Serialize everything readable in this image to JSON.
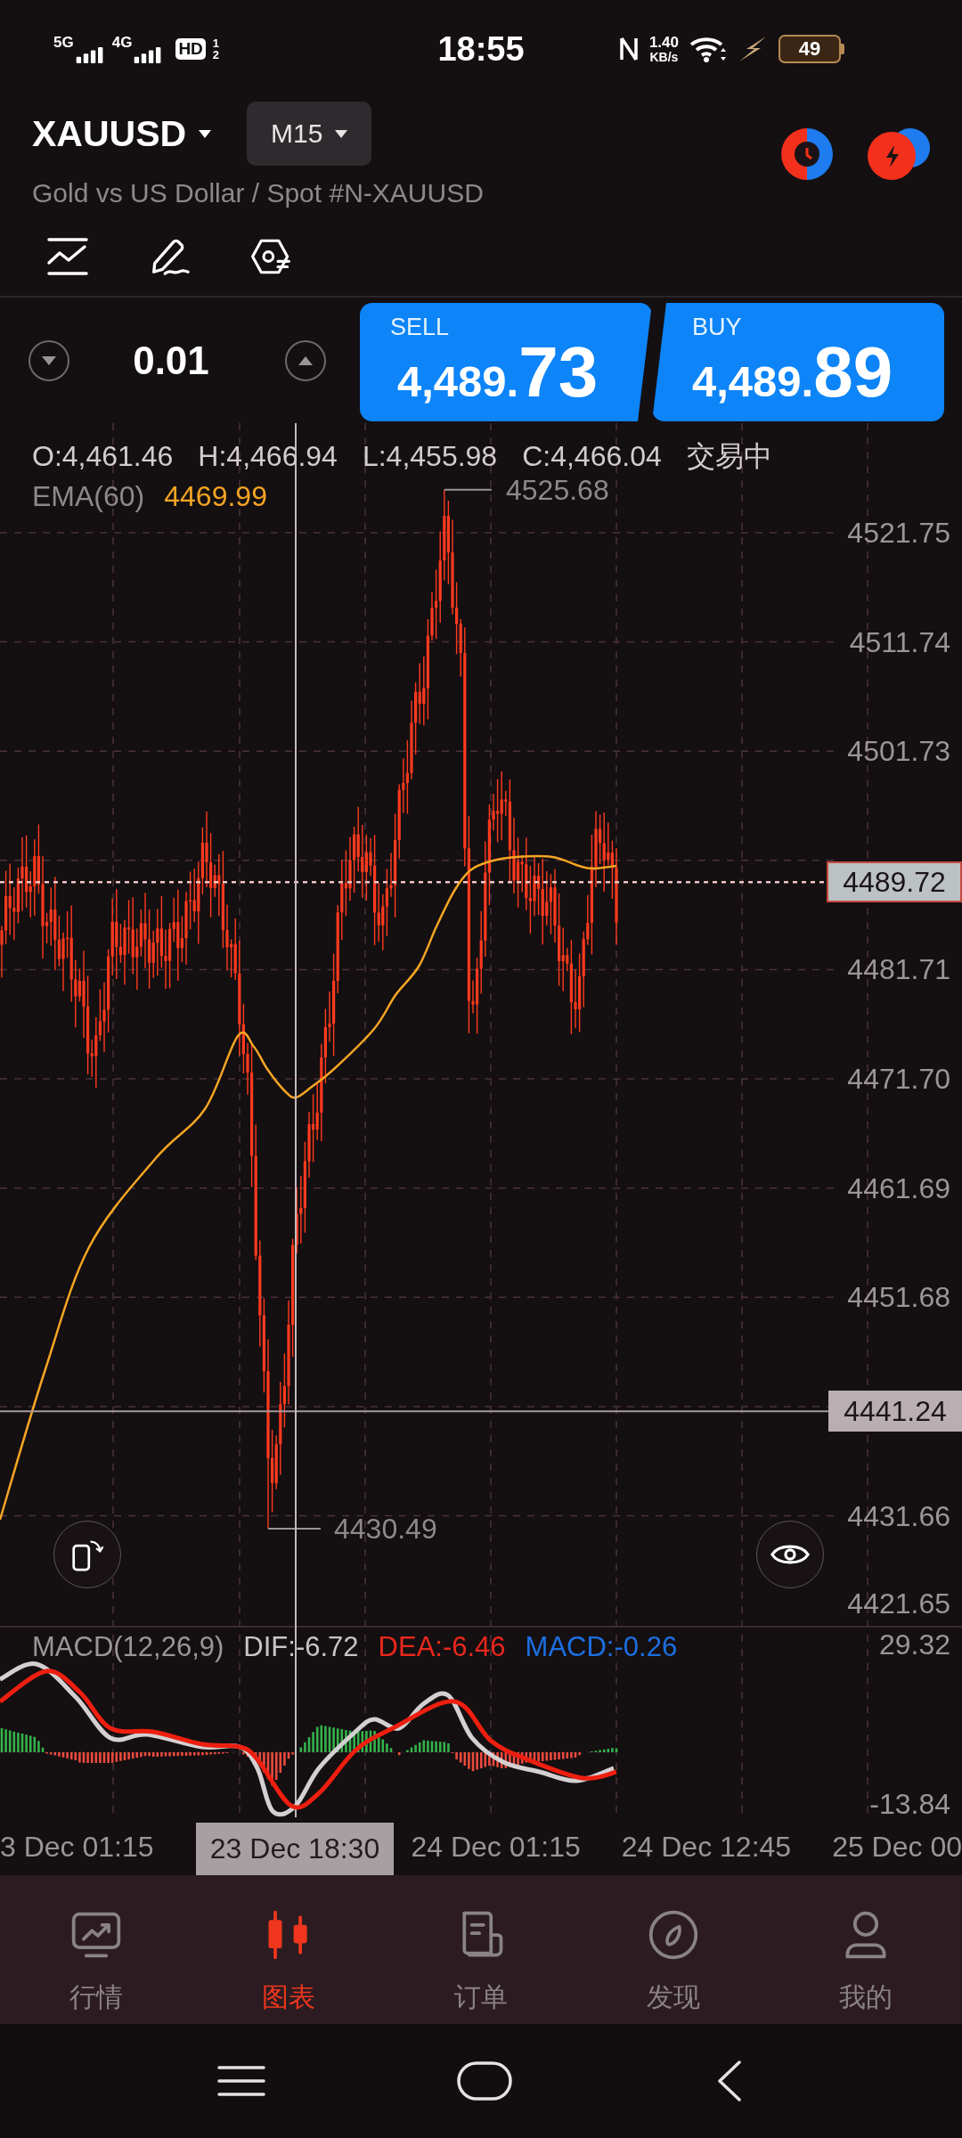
{
  "status_bar": {
    "networks": [
      "5G",
      "4G"
    ],
    "hd_badge": "HD",
    "sim_slots": [
      "1",
      "2"
    ],
    "time": "18:55",
    "speed_value": "1.40",
    "speed_unit": "KB/s",
    "battery": "49"
  },
  "header": {
    "symbol": "XAUUSD",
    "timeframe": "M15",
    "description": "Gold vs US Dollar / Spot #N-XAUUSD"
  },
  "trade": {
    "lot": "0.01",
    "quotes": [
      {
        "kind": "sell",
        "label": "SELL",
        "price_head": "4,489.",
        "price_tail": "73"
      },
      {
        "kind": "buy",
        "label": "BUY",
        "price_head": "4,489.",
        "price_tail": "89"
      }
    ]
  },
  "chart": {
    "ohlc": [
      "O:4,461.46",
      "H:4,466.94",
      "L:4,455.98",
      "C:4,466.04"
    ],
    "market_status": "交易中",
    "indicator": {
      "label": "EMA(60)",
      "value": "4469.99"
    },
    "price_axis": [
      "4521.75",
      "4511.74",
      "4501.73",
      "4481.71",
      "4471.70",
      "4461.69",
      "4451.68",
      "4431.66",
      "4421.65"
    ],
    "current_price": "4489.72",
    "crosshair_price": "4441.24",
    "high_label": "4525.68",
    "low_label": "4430.49"
  },
  "macd": {
    "title": "MACD(12,26,9)",
    "dif": "DIF:-6.72",
    "dea": "DEA:-6.46",
    "macd": "MACD:-0.26",
    "axis": [
      "29.32",
      "-13.84"
    ]
  },
  "time_axis": {
    "labels": [
      "3 Dec 01:15",
      "24 Dec 01:15",
      "24 Dec 12:45",
      "25 Dec 00"
    ],
    "crosshair_time": "23 Dec 18:30"
  },
  "bottom_nav": [
    {
      "label": "行情",
      "selected": false
    },
    {
      "label": "图表",
      "selected": true
    },
    {
      "label": "订单",
      "selected": false
    },
    {
      "label": "发现",
      "selected": false
    },
    {
      "label": "我的",
      "selected": false
    }
  ]
}
